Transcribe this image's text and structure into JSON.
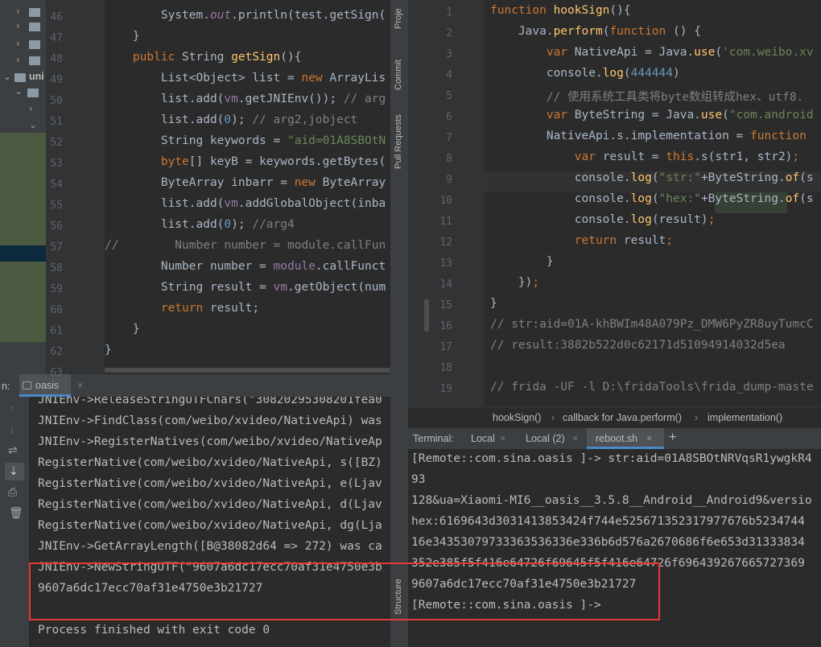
{
  "left_editor": {
    "lines": [
      {
        "n": "46",
        "tokens": [
          [
            "        ",
            "tx"
          ],
          [
            "System.",
            "tx"
          ],
          [
            "out",
            "fld it"
          ],
          [
            ".println(test.getSign(",
            "tx"
          ]
        ]
      },
      {
        "n": "47",
        "tokens": [
          [
            "    }",
            "tx"
          ]
        ]
      },
      {
        "n": "48",
        "tokens": [
          [
            "    ",
            "tx"
          ],
          [
            "public ",
            "kw"
          ],
          [
            "String ",
            "tx"
          ],
          [
            "getSign",
            "fn"
          ],
          [
            "(){",
            "tx"
          ]
        ]
      },
      {
        "n": "49",
        "tokens": [
          [
            "        List<Object> list = ",
            "tx"
          ],
          [
            "new ",
            "kw"
          ],
          [
            "ArrayLis",
            "tx"
          ]
        ]
      },
      {
        "n": "50",
        "tokens": [
          [
            "        list.add(",
            "tx"
          ],
          [
            "vm",
            "fld"
          ],
          [
            ".getJNIEnv()); ",
            "tx"
          ],
          [
            "// arg",
            "cm"
          ]
        ]
      },
      {
        "n": "51",
        "tokens": [
          [
            "        list.add(",
            "tx"
          ],
          [
            "0",
            "num"
          ],
          [
            "); ",
            "tx"
          ],
          [
            "// arg2,jobject",
            "cm"
          ]
        ]
      },
      {
        "n": "52",
        "tokens": [
          [
            "        String keywords = ",
            "tx"
          ],
          [
            "\"aid=01A8SBOtN",
            "str"
          ]
        ]
      },
      {
        "n": "53",
        "tokens": [
          [
            "        ",
            "tx"
          ],
          [
            "byte",
            "kw"
          ],
          [
            "[] keyB = keywords.getBytes(",
            "tx"
          ]
        ]
      },
      {
        "n": "54",
        "tokens": [
          [
            "        ByteArray inbarr = ",
            "tx"
          ],
          [
            "new ",
            "kw"
          ],
          [
            "ByteArray",
            "tx"
          ]
        ]
      },
      {
        "n": "55",
        "tokens": [
          [
            "        list.add(",
            "tx"
          ],
          [
            "vm",
            "fld"
          ],
          [
            ".addGlobalObject(inba",
            "tx"
          ]
        ]
      },
      {
        "n": "56",
        "tokens": [
          [
            "        list.add(",
            "tx"
          ],
          [
            "0",
            "num"
          ],
          [
            "); ",
            "tx"
          ],
          [
            "//arg4",
            "cm"
          ]
        ]
      },
      {
        "n": "57",
        "tokens": [
          [
            "//",
            "cm"
          ],
          [
            "        Number number = module.callFun",
            "cm"
          ]
        ]
      },
      {
        "n": "58",
        "tokens": [
          [
            "        Number number = ",
            "tx"
          ],
          [
            "module",
            "fld"
          ],
          [
            ".callFunct",
            "tx"
          ]
        ]
      },
      {
        "n": "59",
        "tokens": [
          [
            "        String ",
            "tx"
          ],
          [
            "result",
            "tx"
          ],
          [
            " = ",
            "tx"
          ],
          [
            "vm",
            "fld"
          ],
          [
            ".getObject(num",
            "tx"
          ]
        ]
      },
      {
        "n": "60",
        "tokens": [
          [
            "        ",
            "tx"
          ],
          [
            "return ",
            "kw"
          ],
          [
            "result;",
            "tx"
          ]
        ]
      },
      {
        "n": "61",
        "tokens": [
          [
            "    }",
            "tx"
          ]
        ]
      },
      {
        "n": "62",
        "tokens": [
          [
            "}",
            "tx"
          ]
        ]
      },
      {
        "n": "63",
        "tokens": [
          [
            "",
            "tx"
          ]
        ]
      }
    ]
  },
  "right_editor": {
    "lines": [
      {
        "n": "1",
        "tokens": [
          [
            "function ",
            "kw"
          ],
          [
            "hookSign",
            "fn"
          ],
          [
            "(){",
            "tx"
          ]
        ]
      },
      {
        "n": "2",
        "tokens": [
          [
            "    Java.",
            "tx"
          ],
          [
            "perform",
            "fn"
          ],
          [
            "(",
            "tx"
          ],
          [
            "function ",
            "kw"
          ],
          [
            "() {",
            "tx"
          ]
        ]
      },
      {
        "n": "3",
        "tokens": [
          [
            "        ",
            "tx"
          ],
          [
            "var ",
            "kw"
          ],
          [
            "NativeApi = Java.",
            "tx"
          ],
          [
            "use",
            "fn"
          ],
          [
            "(",
            "tx"
          ],
          [
            "'com.weibo.xv",
            "str"
          ]
        ]
      },
      {
        "n": "4",
        "tokens": [
          [
            "        console.",
            "tx"
          ],
          [
            "log",
            "fn"
          ],
          [
            "(",
            "tx"
          ],
          [
            "444444",
            "num"
          ],
          [
            ")",
            "tx"
          ]
        ]
      },
      {
        "n": "5",
        "tokens": [
          [
            "        ",
            "tx"
          ],
          [
            "// 使用系统工具类将byte数组转成hex、utf8.",
            "cm"
          ]
        ]
      },
      {
        "n": "6",
        "tokens": [
          [
            "        ",
            "tx"
          ],
          [
            "var ",
            "kw"
          ],
          [
            "ByteString = Java.",
            "tx"
          ],
          [
            "use",
            "fn"
          ],
          [
            "(",
            "tx"
          ],
          [
            "\"com.android",
            "str"
          ]
        ]
      },
      {
        "n": "7",
        "tokens": [
          [
            "        NativeApi.s.implementation = ",
            "tx"
          ],
          [
            "function ",
            "kw"
          ]
        ]
      },
      {
        "n": "8",
        "tokens": [
          [
            "            ",
            "tx"
          ],
          [
            "var ",
            "kw"
          ],
          [
            "result = ",
            "tx"
          ],
          [
            "this",
            "kw"
          ],
          [
            ".s(str1, str2)",
            "tx"
          ],
          [
            ";",
            "kw"
          ]
        ]
      },
      {
        "n": "9",
        "tokens": [
          [
            "            console.",
            "tx"
          ],
          [
            "log",
            "fn"
          ],
          [
            "(",
            "tx"
          ],
          [
            "\"str:\"",
            "str"
          ],
          [
            "+ByteString.",
            "tx"
          ],
          [
            "of",
            "fn"
          ],
          [
            "(s",
            "tx"
          ]
        ]
      },
      {
        "n": "10",
        "tokens": [
          [
            "            console.",
            "tx"
          ],
          [
            "log",
            "fn"
          ],
          [
            "(",
            "tx"
          ],
          [
            "\"hex:\"",
            "str"
          ],
          [
            "+ByteString.",
            "tx"
          ],
          [
            "of",
            "fn"
          ],
          [
            "(s",
            "tx"
          ]
        ]
      },
      {
        "n": "11",
        "tokens": [
          [
            "            console.",
            "tx"
          ],
          [
            "log",
            "fn"
          ],
          [
            "(result)",
            "tx"
          ],
          [
            ";",
            "kw"
          ]
        ]
      },
      {
        "n": "12",
        "tokens": [
          [
            "            ",
            "tx"
          ],
          [
            "return ",
            "kw"
          ],
          [
            "result",
            "tx"
          ],
          [
            ";",
            "kw"
          ]
        ]
      },
      {
        "n": "13",
        "tokens": [
          [
            "        }",
            "tx"
          ]
        ]
      },
      {
        "n": "14",
        "tokens": [
          [
            "    })",
            "tx"
          ],
          [
            ";",
            "kw"
          ]
        ]
      },
      {
        "n": "15",
        "tokens": [
          [
            "}",
            "tx"
          ]
        ]
      },
      {
        "n": "16",
        "tokens": [
          [
            "// str:aid=01A-khBWIm48A079Pz_DMW6PyZR8uyTumcC",
            "cm"
          ]
        ]
      },
      {
        "n": "17",
        "tokens": [
          [
            "// result:3882b522d0c62171d51094914032d5ea",
            "cm"
          ]
        ]
      },
      {
        "n": "18",
        "tokens": [
          [
            "",
            "tx"
          ]
        ]
      },
      {
        "n": "19",
        "tokens": [
          [
            "// frida -UF -l D:\\fridaTools\\frida_dump-maste",
            "cm"
          ]
        ]
      }
    ]
  },
  "breadcrumbs": [
    "hookSign()",
    "callback for Java.perform()",
    "implementation()"
  ],
  "breadcrumb_sep": "›",
  "terminal": {
    "label": "Terminal:",
    "tabs": [
      "Local",
      "Local (2)",
      "reboot.sh"
    ],
    "add_label": "+",
    "lines": [
      "[Remote::com.sina.oasis ]-> str:aid=01A8SBOtNRVqsR1ywgkR4",
      "93",
      "128&ua=Xiaomi-MI6__oasis__3.5.8__Android__Android9&versio",
      "hex:6169643d3031413853424f744e525671352317977676b5234744",
      "16e34353079733363536336e336b6d576a2670686f6e653d31333834",
      "352e385f5f416e64726f69645f5f416e64726f696439267665727369",
      "9607a6dc17ecc70af31e4750e3b21727",
      "[Remote::com.sina.oasis ]->"
    ]
  },
  "run": {
    "prefix": "n:",
    "tab": "oasis",
    "lines": [
      "JNIEnv->ReleaseStringUTFChars(\"30820295308201fea0",
      "JNIEnv->FindClass(com/weibo/xvideo/NativeApi) was",
      "JNIEnv->RegisterNatives(com/weibo/xvideo/NativeAp",
      "RegisterNative(com/weibo/xvideo/NativeApi, s([BZ)",
      "RegisterNative(com/weibo/xvideo/NativeApi, e(Ljav",
      "RegisterNative(com/weibo/xvideo/NativeApi, d(Ljav",
      "RegisterNative(com/weibo/xvideo/NativeApi, dg(Lja",
      "JNIEnv->GetArrayLength([B@38082d64 => 272) was ca",
      "JNIEnv->NewStringUTF(\"9607a6dc17ecc70af31e4750e3b",
      "9607a6dc17ecc70af31e4750e3b21727",
      "",
      "Process finished with exit code 0"
    ]
  },
  "tree": {
    "items": [
      "uni"
    ]
  },
  "side_tools": [
    "Proje",
    "Commit",
    "Pull Requests",
    "Structure"
  ],
  "colors": {
    "highlight_box": "#e53935",
    "accent_tab": "#4a88c7"
  }
}
